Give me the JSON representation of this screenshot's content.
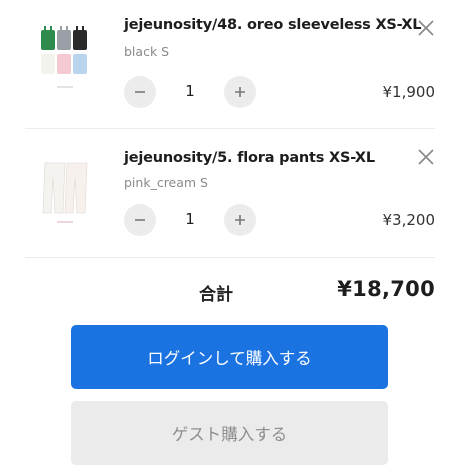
{
  "cart": {
    "items": [
      {
        "title": "jejeunosity/48. oreo sleeveless XS-XL",
        "variant": "black S",
        "quantity": "1",
        "price": "¥1,900",
        "decrease_icon": "minus-icon",
        "increase_icon": "plus-icon",
        "remove_icon": "close-icon"
      },
      {
        "title": "jejeunosity/5. flora pants XS-XL",
        "variant": "pink_cream S",
        "quantity": "1",
        "price": "¥3,200",
        "decrease_icon": "minus-icon",
        "increase_icon": "plus-icon",
        "remove_icon": "close-icon"
      }
    ],
    "total_label": "合計",
    "total_value": "¥18,700"
  },
  "actions": {
    "login_checkout_label": "ログインして購入する",
    "guest_checkout_label": "ゲスト購入する"
  },
  "colors": {
    "primary_button": "#1a73e1",
    "secondary_button": "#ebebeb",
    "stepper_button": "#ececec"
  }
}
